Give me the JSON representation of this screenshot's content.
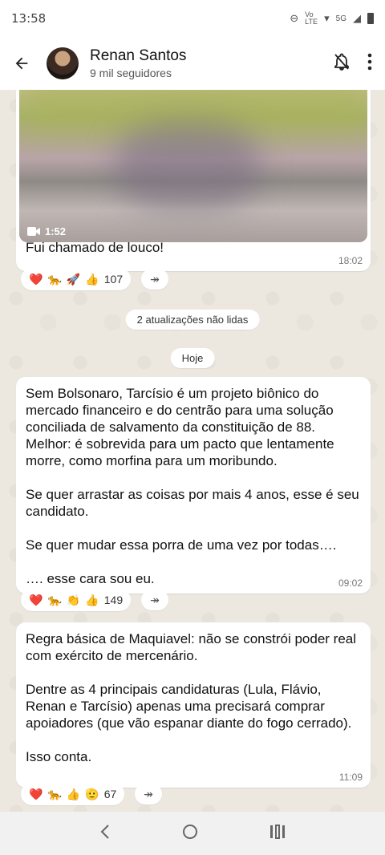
{
  "status_bar": {
    "time": "13:58",
    "icons": [
      "dnd-icon",
      "volte-icon",
      "wifi-icon",
      "signal-5g-icon",
      "signal-icon",
      "battery-icon"
    ],
    "volte_label": "Vo LTE",
    "network_label": "5G"
  },
  "header": {
    "name": "Renan Santos",
    "followers": "9 mil seguidores"
  },
  "messages": [
    {
      "video_duration": "1:52",
      "text": "Fui chamado de louco!",
      "time": "18:02",
      "reactions": [
        "❤️",
        "🐆",
        "🚀",
        "👍"
      ],
      "reaction_count": "107"
    },
    {
      "text": "Sem Bolsonaro, Tarcísio é um projeto biônico do mercado financeiro e do centrão para uma solução conciliada de salvamento da constituição de 88. Melhor: é sobrevida para um pacto que lentamente morre, como morfina para um moribundo.\n\nSe quer arrastar as coisas por mais 4 anos, esse é seu candidato.\n\nSe quer mudar essa porra de uma vez por todas….\n\n…. esse cara sou eu.",
      "time": "09:02",
      "reactions": [
        "❤️",
        "🐆",
        "👏",
        "👍"
      ],
      "reaction_count": "149"
    },
    {
      "text": "Regra básica de Maquiavel: não se constrói poder real com exército de mercenário.\n\nDentre as 4 principais candidaturas (Lula, Flávio, Renan e Tarcísio) apenas uma precisará comprar apoiadores (que vão espanar diante do fogo cerrado).\n\nIsso conta.",
      "time": "11:09",
      "reactions": [
        "❤️",
        "🐆",
        "👍",
        "🫡"
      ],
      "reaction_count": "67"
    }
  ],
  "unread_label": "2 atualizações não lidas",
  "date_label": "Hoje"
}
